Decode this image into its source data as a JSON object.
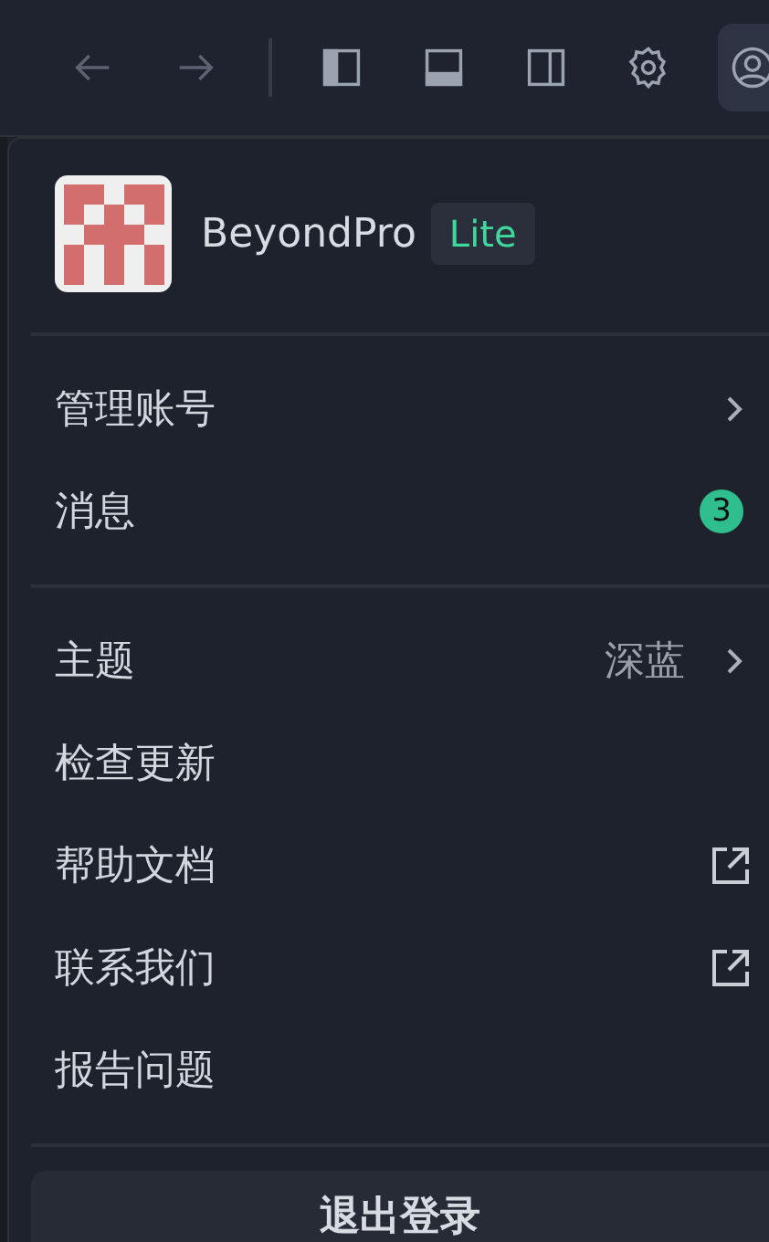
{
  "toolbar": {
    "buttons": [
      {
        "kind": "back",
        "disabled": true
      },
      {
        "kind": "forward",
        "disabled": true
      },
      {
        "kind": "separator"
      },
      {
        "kind": "panel-left"
      },
      {
        "kind": "panel-bottom"
      },
      {
        "kind": "panel-right"
      },
      {
        "kind": "settings"
      },
      {
        "kind": "account",
        "selected": true
      }
    ]
  },
  "menu": {
    "user": {
      "name": "BeyondPro",
      "plan": "Lite"
    },
    "groups": [
      [
        {
          "kind": "submenu",
          "label": "管理账号"
        },
        {
          "kind": "badge",
          "label": "消息",
          "badge": "3"
        }
      ],
      [
        {
          "kind": "submenu",
          "label": "主题",
          "value": "深蓝"
        },
        {
          "kind": "plain",
          "label": "检查更新"
        },
        {
          "kind": "external",
          "label": "帮助文档"
        },
        {
          "kind": "external",
          "label": "联系我们"
        },
        {
          "kind": "plain",
          "label": "报告问题"
        }
      ]
    ],
    "logout": "退出登录"
  }
}
